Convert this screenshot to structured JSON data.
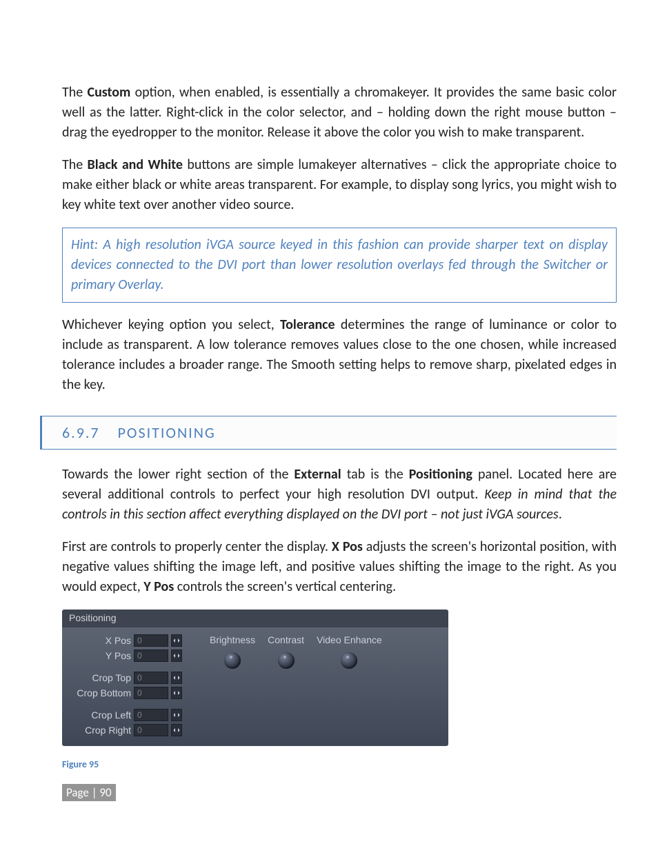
{
  "para1": {
    "pre": "The ",
    "bold": "Custom",
    "post": " option, when enabled, is essentially a chromakeyer.  It provides the same basic color well as the latter. Right-click in the color selector, and – holding down the right mouse button – drag the eyedropper to the monitor.  Release it above the color you wish to make transparent."
  },
  "para2": {
    "pre": "The ",
    "bold": "Black and White",
    "post": " buttons are simple lumakeyer alternatives – click the appropriate choice to make either black or white areas transparent. For example, to display song lyrics, you might wish to key white text over another video source."
  },
  "hint": "Hint: A high resolution iVGA source keyed in this fashion can provide sharper text on display devices connected to the DVI port than lower resolution overlays fed through the Switcher or primary Overlay.",
  "para3": {
    "pre": "Whichever keying option you select, ",
    "bold": "Tolerance",
    "post": " determines the range of luminance or color to include as transparent. A low tolerance removes values close to the one chosen, while increased tolerance includes a broader range. The Smooth setting helps to remove sharp, pixelated edges in the key."
  },
  "section": {
    "number": "6.9.7",
    "title": "POSITIONING"
  },
  "para4": {
    "a": "Towards the lower right section of the ",
    "b": "External",
    "c": " tab is the ",
    "d": "Positioning",
    "e": " panel.  Located here are several additional controls to perfect your high resolution DVI output.  ",
    "f": "Keep in mind that the controls in this section affect everything displayed on the DVI port – not just iVGA sources",
    "g": "."
  },
  "para5": {
    "a": "First are controls to properly center the display. ",
    "b": "X Pos",
    "c": " adjusts the screen's horizontal position, with negative values shifting the image left, and positive values shifting the image to the right. As you would expect, ",
    "d": "Y Pos",
    "e": " controls the screen's vertical centering."
  },
  "panel": {
    "title": "Positioning",
    "fields": {
      "xpos": {
        "label": "X Pos",
        "value": "0"
      },
      "ypos": {
        "label": "Y Pos",
        "value": "0"
      },
      "croptop": {
        "label": "Crop Top",
        "value": "0"
      },
      "cropbottom": {
        "label": "Crop Bottom",
        "value": "0"
      },
      "cropleft": {
        "label": "Crop Left",
        "value": "0"
      },
      "cropright": {
        "label": "Crop Right",
        "value": "0"
      }
    },
    "knobs": {
      "brightness": "Brightness",
      "contrast": "Contrast",
      "videoenhance": "Video Enhance"
    }
  },
  "figure": "Figure 95",
  "footer": "Page | 90"
}
